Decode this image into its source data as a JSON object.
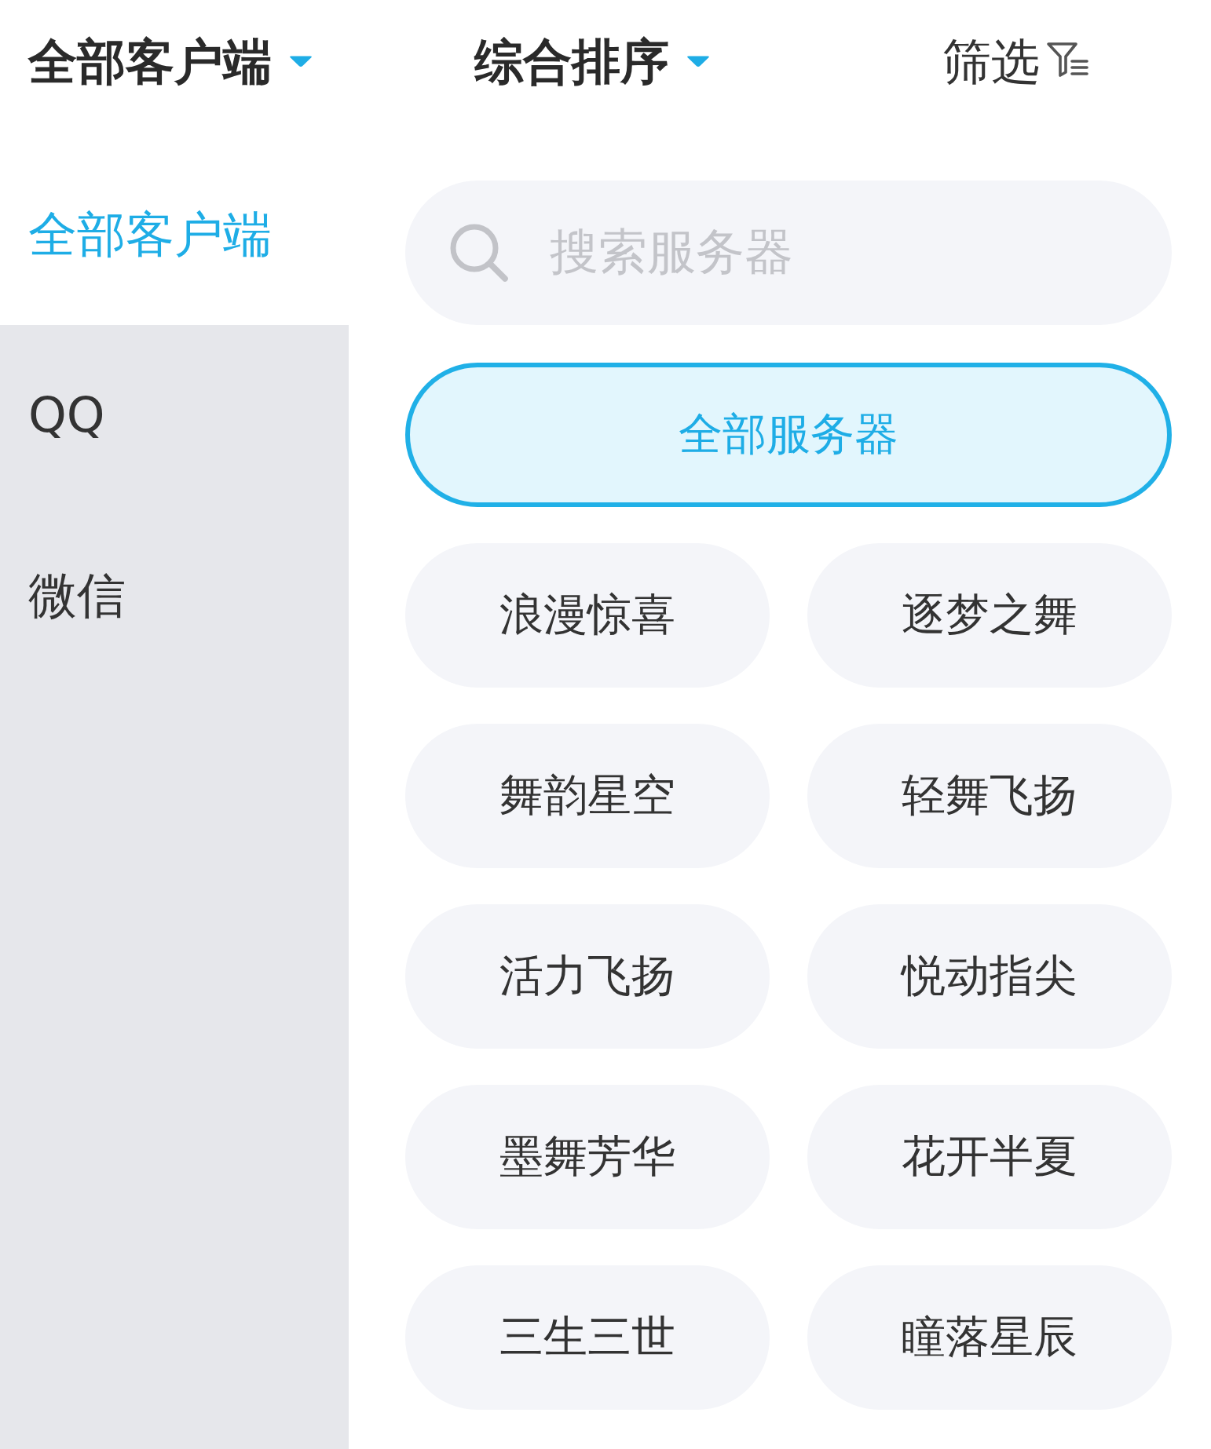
{
  "header": {
    "tabs": [
      {
        "label": "全部客户端",
        "kind": "dropdown"
      },
      {
        "label": "综合排序",
        "kind": "dropdown"
      },
      {
        "label": "筛选",
        "kind": "filter"
      }
    ]
  },
  "sidebar": {
    "items": [
      {
        "label": "全部客户端",
        "selected": true
      },
      {
        "label": "QQ",
        "selected": false
      },
      {
        "label": "微信",
        "selected": false
      }
    ]
  },
  "search": {
    "placeholder": "搜索服务器"
  },
  "servers": [
    {
      "label": "全部服务器",
      "kind": "all",
      "selected": true
    },
    {
      "label": "浪漫惊喜",
      "kind": "chip",
      "selected": false
    },
    {
      "label": "逐梦之舞",
      "kind": "chip",
      "selected": false
    },
    {
      "label": "舞韵星空",
      "kind": "chip",
      "selected": false
    },
    {
      "label": "轻舞飞扬",
      "kind": "chip",
      "selected": false
    },
    {
      "label": "活力飞扬",
      "kind": "chip",
      "selected": false
    },
    {
      "label": "悦动指尖",
      "kind": "chip",
      "selected": false
    },
    {
      "label": "墨舞芳华",
      "kind": "chip",
      "selected": false
    },
    {
      "label": "花开半夏",
      "kind": "chip",
      "selected": false
    },
    {
      "label": "三生三世",
      "kind": "chip",
      "selected": false
    },
    {
      "label": "瞳落星辰",
      "kind": "chip",
      "selected": false
    }
  ]
}
